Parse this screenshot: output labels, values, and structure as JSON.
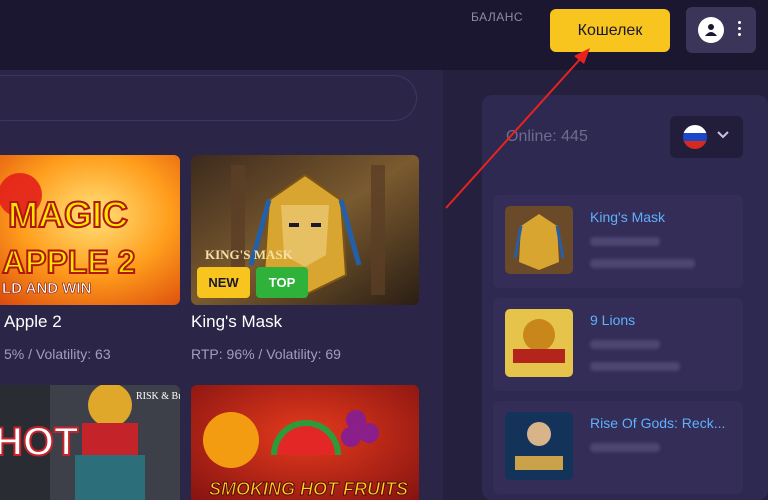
{
  "header": {
    "balance_label": "БАЛАНС",
    "wallet_label": "Кошелек"
  },
  "games": [
    {
      "title": "Apple 2",
      "meta": "5% / Volatility: 63",
      "art_top": "MAGIC",
      "art_bottom": "APPLE 2",
      "art_line": "LD AND WIN"
    },
    {
      "title": "King's Mask",
      "meta": "RTP: 96% / Volatility: 69",
      "art_label": "KING'S MASK",
      "badges": [
        "NEW",
        "TOP"
      ]
    },
    {
      "art_label": "HOT",
      "art_corner": "RISK & Buy"
    },
    {
      "art_label": "SMOKING HOT FRUITS"
    }
  ],
  "sidebar": {
    "online_label": "Online: 445",
    "language_flag": "russia-flag-icon",
    "recent_wins": [
      {
        "name": "King's Mask"
      },
      {
        "name": "9 Lions"
      },
      {
        "name": "Rise Of Gods: Reck..."
      }
    ]
  },
  "colors": {
    "accent": "#f7c51d",
    "badge_new": "#f7c51d",
    "badge_top": "#2fb23a",
    "link": "#5fb0ff"
  }
}
